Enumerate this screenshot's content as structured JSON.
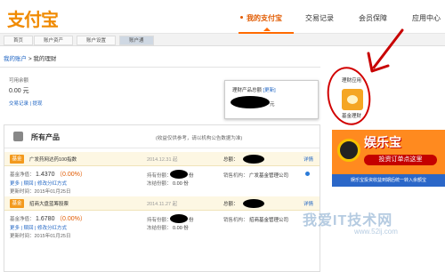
{
  "header": {
    "logo_text": "支付宝",
    "nav": [
      {
        "label": "我的支付宝",
        "active": true
      },
      {
        "label": "交易记录",
        "active": false
      },
      {
        "label": "会员保障",
        "active": false
      },
      {
        "label": "应用中心",
        "active": false
      }
    ],
    "accent_color": "#ff6a00"
  },
  "subnav": {
    "tabs": [
      {
        "label": "首页",
        "active": false
      },
      {
        "label": "账户资产",
        "active": false
      },
      {
        "label": "账户设置",
        "active": false
      },
      {
        "label": "账户通",
        "active": true
      }
    ]
  },
  "breadcrumb": {
    "root": "我的账户",
    "separator": ">",
    "current": "我的理财"
  },
  "balance": {
    "label": "可用余额",
    "value": "0.00",
    "unit": "元",
    "links": "交易记录 | 提现"
  },
  "popup": {
    "title": "理财产品总额",
    "update_link": "[更新]",
    "unit": "元"
  },
  "side": {
    "app_label": "理财应用",
    "app_icon": "piggy-bank-icon",
    "app_caption": "基金理财"
  },
  "ad": {
    "brand": "娱乐宝",
    "pill": "投资订单点这里",
    "strip": "娱乐宝投资收益到期后统一转入余额宝"
  },
  "products": {
    "title": "所有产品",
    "note": "(收益仅供参考，请以机构公告数据为准)",
    "funds": [
      {
        "tag": "基金",
        "name": "广发药网达药100指数",
        "date": "2014.12.31 起",
        "total_label": "总额：",
        "detail": "详情",
        "nav_label": "基金净值：",
        "nav_value": "1.4370",
        "pct": "（0.00%）",
        "holding_label": "持有份额：",
        "holding_suffix": "份",
        "manager_label": "销售机构：",
        "manager": "广发基金管理公司",
        "links": "更多 | 赎回 | 修改分红方式",
        "pending_label": "冻结份额：",
        "pending_value": "0.00 份",
        "update_time": "更新时间：2015年01月25日"
      },
      {
        "tag": "基金",
        "name": "招商大盘蓝筹股票",
        "date": "2014.11.27 起",
        "total_label": "总额：",
        "detail": "详情",
        "nav_label": "基金净值：",
        "nav_value": "1.6780",
        "pct": "（0.00%）",
        "holding_label": "持有份额：",
        "holding_suffix": "份",
        "manager_label": "销售机构：",
        "manager": "招商基金管理公司",
        "links": "更多 | 赎回 | 修改分红方式",
        "pending_label": "冻结份额：",
        "pending_value": "0.00 份",
        "update_time": "更新时间：2015年01月25日"
      }
    ]
  },
  "watermark": {
    "text": "我爱IT技术网",
    "url": "www.52ij.com"
  }
}
